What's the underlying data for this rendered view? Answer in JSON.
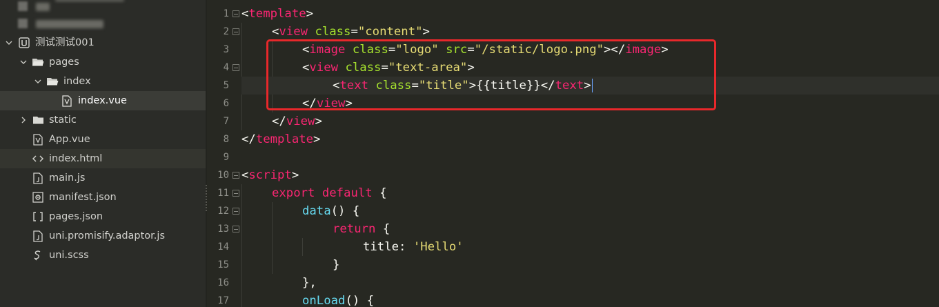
{
  "sidebar": {
    "project": {
      "name": "测试测试001",
      "icon": "uniapp-project-icon"
    },
    "items": [
      {
        "id": "pages",
        "label": "pages",
        "icon": "folder-open-icon",
        "expanded": true
      },
      {
        "id": "index",
        "label": "index",
        "icon": "folder-open-icon",
        "expanded": true
      },
      {
        "id": "index-vue",
        "label": "index.vue",
        "icon": "vue-file-icon",
        "selected": true
      },
      {
        "id": "static",
        "label": "static",
        "icon": "folder-icon",
        "expanded": false
      },
      {
        "id": "app-vue",
        "label": "App.vue",
        "icon": "vue-file-icon"
      },
      {
        "id": "index-html",
        "label": "index.html",
        "icon": "html-file-icon",
        "hover": true
      },
      {
        "id": "main-js",
        "label": "main.js",
        "icon": "js-file-icon"
      },
      {
        "id": "manifest-json",
        "label": "manifest.json",
        "icon": "manifest-file-icon"
      },
      {
        "id": "pages-json",
        "label": "pages.json",
        "icon": "json-file-icon"
      },
      {
        "id": "uni-promisify",
        "label": "uni.promisify.adaptor.js",
        "icon": "js-file-icon"
      },
      {
        "id": "uni-scss",
        "label": "uni.scss",
        "icon": "scss-file-icon"
      }
    ]
  },
  "editor": {
    "line_numbers": [
      "1",
      "2",
      "3",
      "4",
      "5",
      "6",
      "7",
      "8",
      "9",
      "10",
      "11",
      "12",
      "13",
      "14",
      "15",
      "16",
      "17"
    ],
    "current_line": 5,
    "highlight_color": "#e8282b",
    "lines": {
      "l1": {
        "open": "<",
        "tag": "template",
        "close": ">"
      },
      "l2": {
        "open": "<",
        "tag": "view",
        "attr": "class",
        "eq": "=",
        "val": "\"content\"",
        "close": ">"
      },
      "l3": {
        "open": "<",
        "tag": "image",
        "attr1": "class",
        "eq1": "=",
        "val1": "\"logo\"",
        "attr2": "src",
        "eq2": "=",
        "val2": "\"/static/logo.png\"",
        "mid": "></",
        "endtag": "image",
        "close": ">"
      },
      "l4": {
        "open": "<",
        "tag": "view",
        "attr": "class",
        "eq": "=",
        "val": "\"text-area\"",
        "close": ">"
      },
      "l5": {
        "open": "<",
        "tag": "text",
        "attr": "class",
        "eq": "=",
        "val": "\"title\"",
        "content": ">{{title}}</",
        "endtag": "text",
        "close": ">"
      },
      "l6": {
        "open": "</",
        "tag": "view",
        "close": ">"
      },
      "l7": {
        "open": "</",
        "tag": "view",
        "close": ">"
      },
      "l8": {
        "open": "</",
        "tag": "template",
        "close": ">"
      },
      "l10": {
        "open": "<",
        "tag": "script",
        "close": ">"
      },
      "l11": {
        "kw1": "export",
        "kw2": "default",
        "rest": " {"
      },
      "l12": {
        "fn": "data",
        "rest": "() {"
      },
      "l13": {
        "kw": "return",
        "rest": " {"
      },
      "l14": {
        "prop": "title",
        "sep": ": ",
        "str": "'Hello'"
      },
      "l15": {
        "text": "}"
      },
      "l16": {
        "text": "},"
      },
      "l17": {
        "fn": "onLoad",
        "rest": "() {"
      }
    }
  }
}
